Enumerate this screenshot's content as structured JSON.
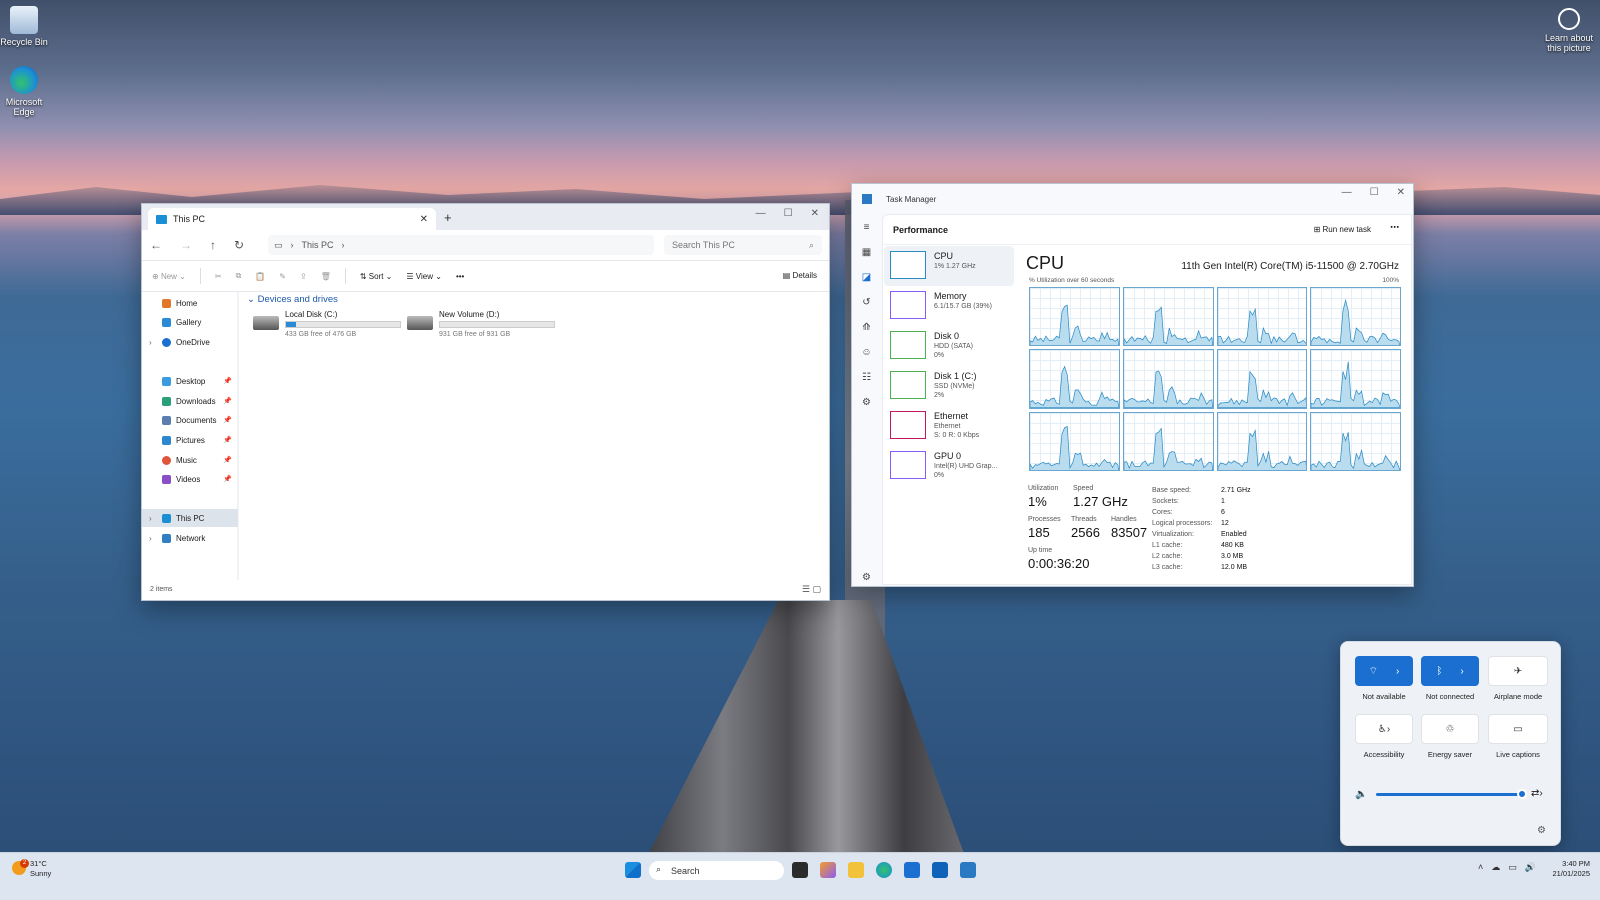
{
  "desktop": {
    "icons": [
      {
        "label": "Recycle Bin"
      },
      {
        "label": "Microsoft Edge"
      }
    ],
    "learn": "Learn about this picture"
  },
  "explorer": {
    "tab_title": "This PC",
    "breadcrumb": [
      "This PC"
    ],
    "search_placeholder": "Search This PC",
    "toolbar": {
      "new": "New",
      "sort": "Sort",
      "view": "View",
      "details": "Details"
    },
    "sidebar": {
      "home": "Home",
      "gallery": "Gallery",
      "onedrive": "OneDrive",
      "desktop": "Desktop",
      "downloads": "Downloads",
      "documents": "Documents",
      "pictures": "Pictures",
      "music": "Music",
      "videos": "Videos",
      "thispc": "This PC",
      "network": "Network"
    },
    "group": "Devices and drives",
    "drives": [
      {
        "name": "Local Disk (C:)",
        "free": "433 GB free of 476 GB",
        "used_fraction": 0.09
      },
      {
        "name": "New Volume (D:)",
        "free": "931 GB free of 931 GB",
        "used_fraction": 0.0
      }
    ],
    "status": "2 items"
  },
  "taskmgr": {
    "title": "Task Manager",
    "section": "Performance",
    "run_new_task": "Run new task",
    "list": [
      {
        "name": "CPU",
        "sub1": "1% 1.27 GHz",
        "sub2": ""
      },
      {
        "name": "Memory",
        "sub1": "6.1/15.7 GB (39%)",
        "sub2": ""
      },
      {
        "name": "Disk 0",
        "sub1": "HDD (SATA)",
        "sub2": "0%"
      },
      {
        "name": "Disk 1 (C:)",
        "sub1": "SSD (NVMe)",
        "sub2": "2%"
      },
      {
        "name": "Ethernet",
        "sub1": "Ethernet",
        "sub2": "S: 0 R: 0 Kbps"
      },
      {
        "name": "GPU 0",
        "sub1": "Intel(R) UHD Grap...",
        "sub2": "0%"
      }
    ],
    "cpu_heading": "CPU",
    "cpu_model": "11th Gen Intel(R) Core(TM) i5-11500 @ 2.70GHz",
    "util_caption": "% Utilization over 60 seconds",
    "max_label": "100%",
    "stats": {
      "utilization_label": "Utilization",
      "utilization": "1%",
      "speed_label": "Speed",
      "speed": "1.27 GHz",
      "processes_label": "Processes",
      "processes": "185",
      "threads_label": "Threads",
      "threads": "2566",
      "handles_label": "Handles",
      "handles": "83507",
      "uptime_label": "Up time",
      "uptime": "0:00:36:20"
    },
    "details_keys": [
      "Base speed:",
      "Sockets:",
      "Cores:",
      "Logical processors:",
      "Virtualization:",
      "L1 cache:",
      "L2 cache:",
      "L3 cache:"
    ],
    "details_vals": [
      "2.71 GHz",
      "1",
      "6",
      "12",
      "Enabled",
      "480 KB",
      "3.0 MB",
      "12.0 MB"
    ]
  },
  "quick": {
    "wifi": "Not available",
    "bluetooth": "Not connected",
    "airplane": "Airplane mode",
    "accessibility": "Accessibility",
    "energy": "Energy saver",
    "captions": "Live captions",
    "volume_level": 0.96
  },
  "taskbar": {
    "temp": "31°C",
    "cond": "Sunny",
    "badge": "2",
    "search": "Search",
    "time": "3:40 PM",
    "date": "21/01/2025"
  },
  "colors": {
    "accent": "#1a6fd0",
    "chart_line": "#2a8ac4"
  }
}
